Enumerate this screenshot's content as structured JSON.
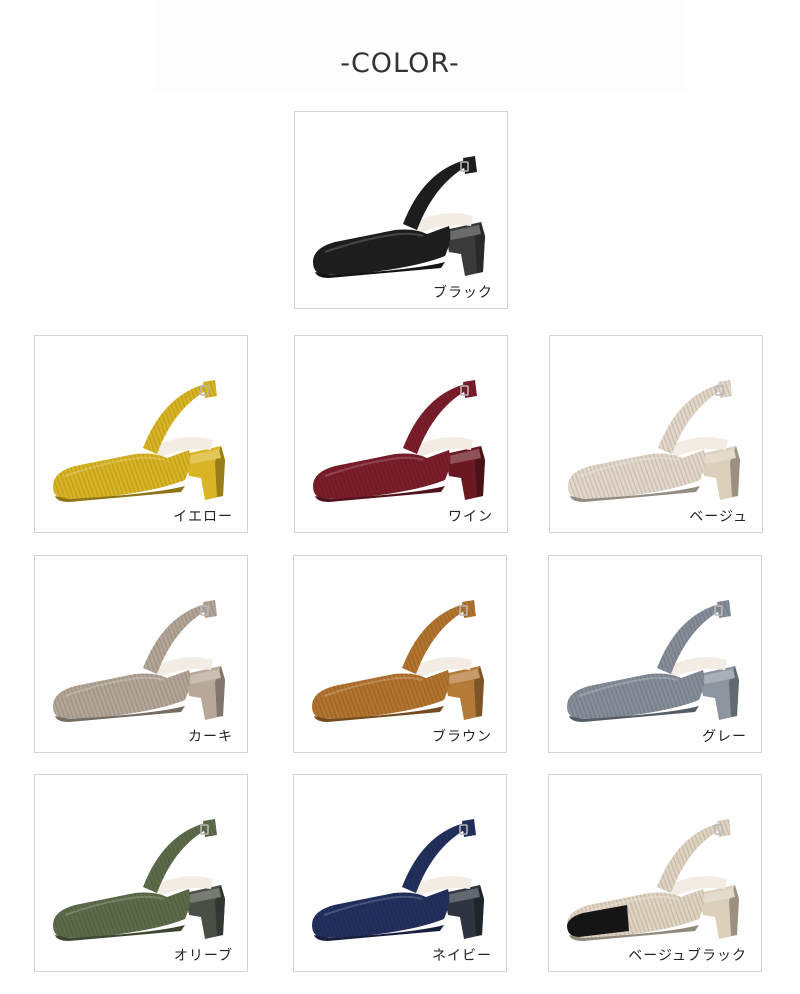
{
  "title": "-COLOR-",
  "colors": [
    {
      "label": "ブラック",
      "color": "#1e1e1e",
      "heel": "#3a3a3a",
      "toe": ""
    },
    {
      "label": "イエロー",
      "color": "#d9b424",
      "heel": "#d9b424",
      "toe": ""
    },
    {
      "label": "ワイン",
      "color": "#7b1d2a",
      "heel": "#6a1822",
      "toe": ""
    },
    {
      "label": "ベージュ",
      "color": "#e2d7c8",
      "heel": "#dccfbb",
      "toe": ""
    },
    {
      "label": "カーキ",
      "color": "#b3a596",
      "heel": "#b8a89a",
      "toe": ""
    },
    {
      "label": "ブラウン",
      "color": "#b2742e",
      "heel": "#b47a3a",
      "toe": ""
    },
    {
      "label": "グレー",
      "color": "#858d98",
      "heel": "#8d96a0",
      "toe": ""
    },
    {
      "label": "オリーブ",
      "color": "#5d6b4a",
      "heel": "#4a4f46",
      "toe": ""
    },
    {
      "label": "ネイビー",
      "color": "#23305e",
      "heel": "#2f3440",
      "toe": ""
    },
    {
      "label": "ベージュブラック",
      "color": "#e0d3c1",
      "heel": "#dccfbb",
      "toe": "#151515"
    }
  ]
}
